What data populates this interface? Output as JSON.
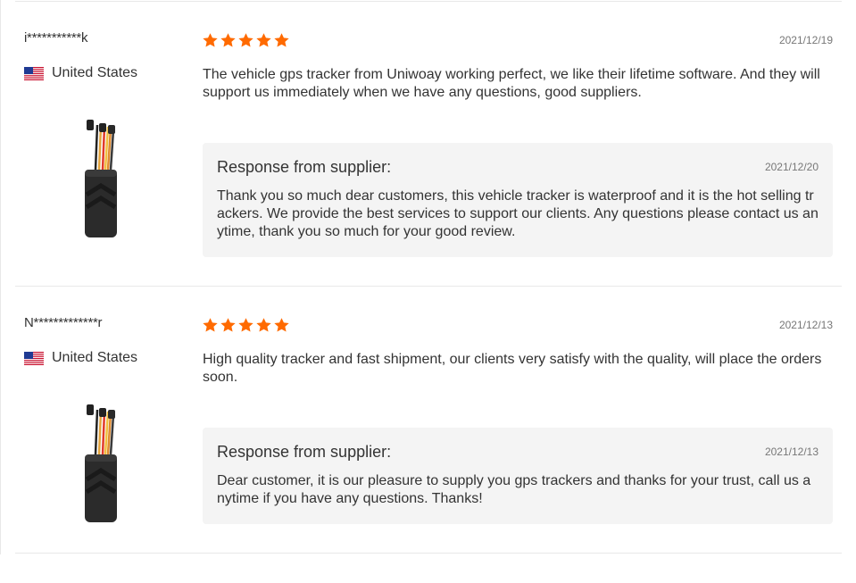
{
  "colors": {
    "star": "#ff6a00",
    "response_bg": "#f4f4f4",
    "divider": "#e8e8e8"
  },
  "reviews": [
    {
      "buyer": "i***********k",
      "country": "United States",
      "country_flag_icon": "us-flag-icon",
      "product_image": "gps-tracker-thumbnail",
      "rating": 5,
      "date": "2021/12/19",
      "text": "The vehicle gps tracker from Uniwoay working perfect, we like their lifetime software. And they will support us immediately when we have any questions, good suppliers.",
      "response": {
        "title": "Response from supplier:",
        "date": "2021/12/20",
        "text": "Thank you so much dear customers, this vehicle tracker is waterproof and it is the hot selling trackers. We provide the best services to support our clients. Any questions please contact us anytime, thank you so much for your good review."
      }
    },
    {
      "buyer": "N*************r",
      "country": "United States",
      "country_flag_icon": "us-flag-icon",
      "product_image": "gps-tracker-thumbnail",
      "rating": 5,
      "date": "2021/12/13",
      "text": "High quality tracker and fast shipment, our clients very satisfy with the quality, will place the orders soon.",
      "response": {
        "title": "Response from supplier:",
        "date": "2021/12/13",
        "text": "Dear customer, it is our pleasure to supply you gps trackers and thanks for your trust, call us anytime if you have any questions. Thanks!"
      }
    }
  ]
}
